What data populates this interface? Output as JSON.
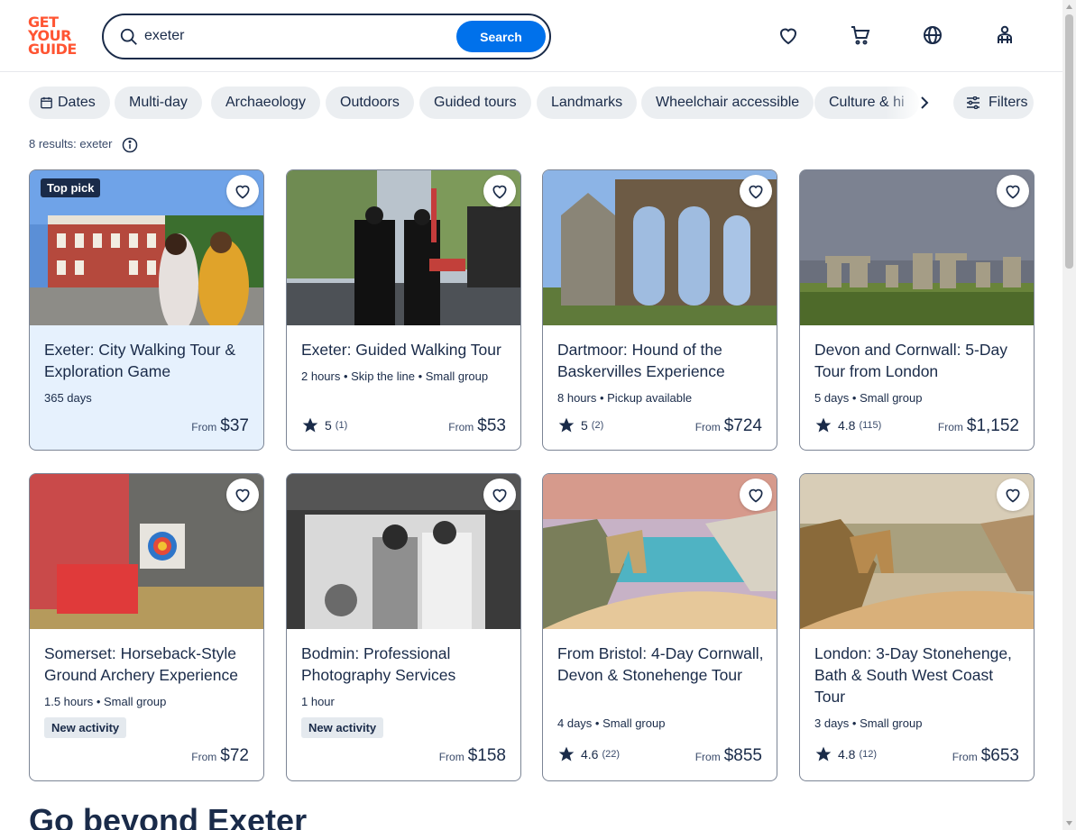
{
  "header": {
    "logo_lines": [
      "GET",
      "YOUR",
      "GUIDE"
    ],
    "search_value": "exeter",
    "search_button": "Search"
  },
  "chips": [
    "Dates",
    "Multi-day",
    "Archaeology",
    "Outdoors",
    "Guided tours",
    "Landmarks",
    "Wheelchair accessible",
    "Culture & hi"
  ],
  "filters_label": "Filters",
  "results_text": "8 results: exeter",
  "cards": [
    {
      "title": "Exeter: City Walking Tour & Exploration Game",
      "meta": "365 days",
      "badge": "Top pick",
      "rating": "",
      "count": "",
      "new": "",
      "price_from": "From",
      "price": "$37"
    },
    {
      "title": "Exeter: Guided Walking Tour",
      "meta": "2 hours • Skip the line • Small group",
      "badge": "",
      "rating": "5",
      "count": "(1)",
      "new": "",
      "price_from": "From",
      "price": "$53"
    },
    {
      "title": "Dartmoor: Hound of the Baskervilles Experience",
      "meta": "8 hours • Pickup available",
      "badge": "",
      "rating": "5",
      "count": "(2)",
      "new": "",
      "price_from": "From",
      "price": "$724"
    },
    {
      "title": "Devon and Cornwall: 5-Day Tour from London",
      "meta": "5 days • Small group",
      "badge": "",
      "rating": "4.8",
      "count": "(115)",
      "new": "",
      "price_from": "From",
      "price": "$1,152"
    },
    {
      "title": "Somerset: Horseback-Style Ground Archery Experience",
      "meta": "1.5 hours • Small group",
      "badge": "",
      "rating": "",
      "count": "",
      "new": "New activity",
      "price_from": "From",
      "price": "$72"
    },
    {
      "title": "Bodmin: Professional Photography Services",
      "meta": "1 hour",
      "badge": "",
      "rating": "",
      "count": "",
      "new": "New activity",
      "price_from": "From",
      "price": "$158"
    },
    {
      "title": "From Bristol: 4-Day Cornwall, Devon & Stonehenge Tour",
      "meta": "4 days • Small group",
      "badge": "",
      "rating": "4.6",
      "count": "(22)",
      "new": "",
      "price_from": "From",
      "price": "$855"
    },
    {
      "title": "London: 3-Day Stonehenge, Bath & South West Coast Tour",
      "meta": "3 days • Small group",
      "badge": "",
      "rating": "4.8",
      "count": "(12)",
      "new": "",
      "price_from": "From",
      "price": "$653"
    }
  ],
  "section_title": "Go beyond Exeter",
  "colors": {
    "brand": "#ff5533",
    "accent": "#0071eb",
    "text": "#1a2b49",
    "highlight_card": "#e6f1fd"
  }
}
